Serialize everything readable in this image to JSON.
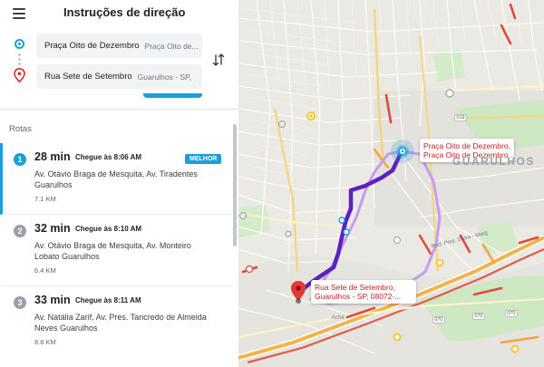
{
  "header": {
    "title": "Instruções de direção"
  },
  "origin": {
    "main": "Praça Oito de Dezembro",
    "sub": "Praça Oito de..."
  },
  "destination": {
    "main": "Rua Sete de Setembro",
    "sub": "Guarulhos - SP,"
  },
  "routes_label": "Rotas",
  "routes": [
    {
      "number": "1",
      "duration": "28 min",
      "arrival": "Chegue às 8:06 AM",
      "badge": "MELHOR",
      "via": "Av. Otávio Braga de Mesquita, Av. Tiradentes Guarulhos",
      "distance": "7.1 KM"
    },
    {
      "number": "2",
      "duration": "32 min",
      "arrival": "Chegue às 8:10 AM",
      "via": "Av. Otávio Braga de Mesquita, Av. Monteiro Lobato Guarulhos",
      "distance": "6.4 KM"
    },
    {
      "number": "3",
      "duration": "33 min",
      "arrival": "Chegue às 8:11 AM",
      "via": "Av. Natália Zarif, Av. Pres. Tancredo de Almeida Neves Guarulhos",
      "distance": "8.8 KM"
    }
  ],
  "map": {
    "origin_label_line1": "Praça Oito de Dezembro,",
    "origin_label_line2": "Praça Oito de Dezembro ...",
    "dest_label_line1": "Rua Sete de Setembro,",
    "dest_label_line2": "Guarulhos - SP, 08072-...",
    "city_label": "GUARULHOS",
    "road_label": "Rod. Pres. Dutra - Marg",
    "area_label": "Aché",
    "shields": [
      "019",
      "070",
      "070",
      "070"
    ]
  },
  "colors": {
    "accent": "#1a9fd8",
    "route_main": "#5c1fc2",
    "route_alt": "#c59cf0",
    "label_text": "#c5221f"
  }
}
